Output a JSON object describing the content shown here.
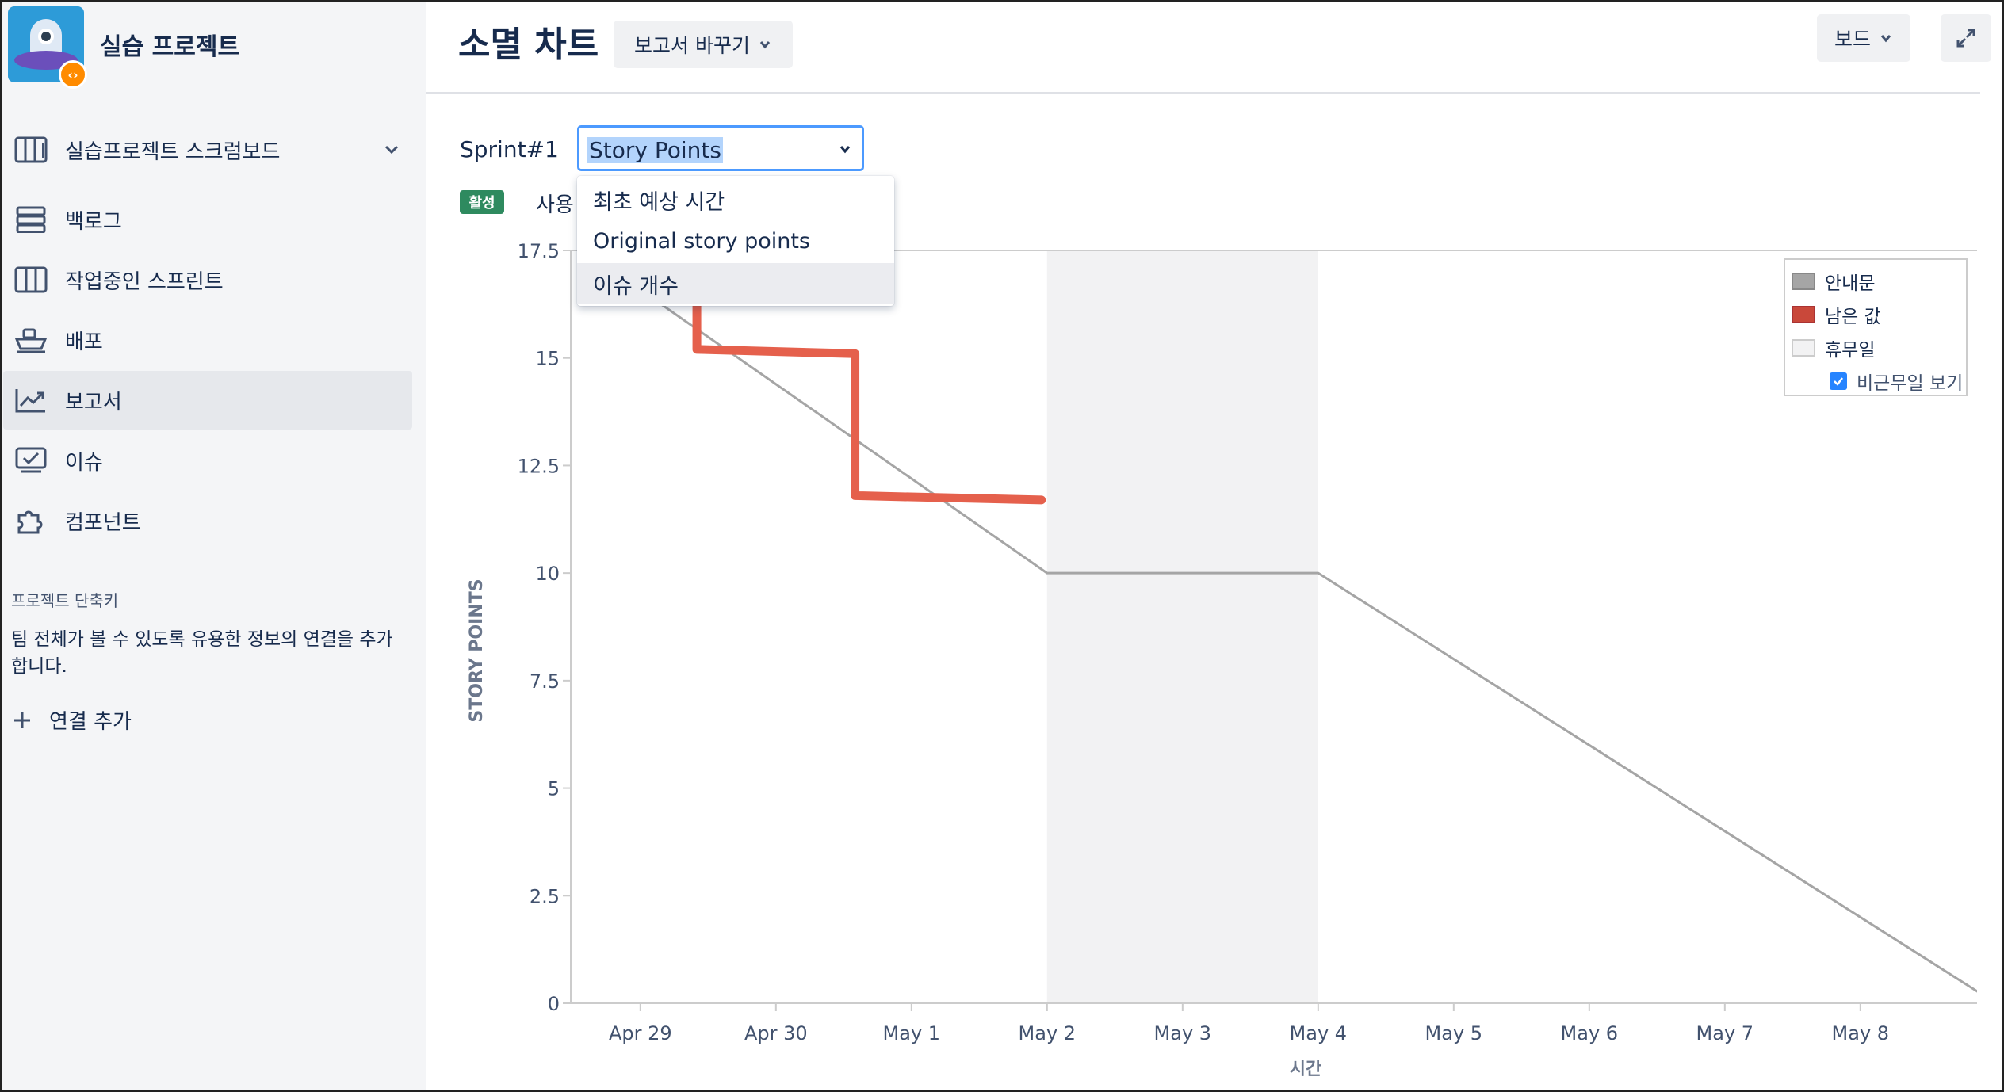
{
  "sidebar": {
    "project_name": "실습 프로젝트",
    "project_badge": "‹›",
    "items": [
      {
        "label": "실습프로젝트 스크럼보드",
        "icon": "board-icon"
      },
      {
        "label": "백로그",
        "icon": "backlog-icon"
      },
      {
        "label": "작업중인 스프린트",
        "icon": "sprint-columns-icon"
      },
      {
        "label": "배포",
        "icon": "ship-icon"
      },
      {
        "label": "보고서",
        "icon": "chart-line-icon",
        "selected": true
      },
      {
        "label": "이슈",
        "icon": "issues-icon"
      },
      {
        "label": "컴포넌트",
        "icon": "puzzle-icon"
      }
    ],
    "shortcuts_title": "프로젝트 단축키",
    "shortcuts_desc": "팀 전체가 볼 수 있도록 유용한 정보의 연결을 추가합니다.",
    "add_link": "연결 추가"
  },
  "header": {
    "title": "소멸 차트",
    "switch_report": "보고서 바꾸기",
    "board_button": "보드"
  },
  "controls": {
    "sprint_label": "Sprint#1",
    "estimate_selected": "Story Points",
    "options": [
      "최초 예상 시간",
      "Original story points",
      "이슈 개수"
    ],
    "highlighted_option": 2,
    "status_lozenge": "활성",
    "usage_text_partial": "사용"
  },
  "colors": {
    "guideline": "#a5a5a5",
    "remaining": "#e5604c",
    "nonworking": "#f2f2f3",
    "accent": "#4c9aff"
  },
  "chart_data": {
    "type": "line",
    "title": "",
    "xlabel": "시간",
    "ylabel": "STORY POINTS",
    "ylim": [
      0,
      17.5
    ],
    "y_ticks": [
      "0",
      "2.5",
      "5",
      "7.5",
      "10",
      "12.5",
      "15",
      "17.5"
    ],
    "x_ticks": [
      "Apr 29",
      "Apr 30",
      "May 1",
      "May 2",
      "May 3",
      "May 4",
      "May 5",
      "May 6",
      "May 7",
      "May 8"
    ],
    "nonworking_range": [
      "May 2",
      "May 4"
    ],
    "series": [
      {
        "name": "안내문",
        "color": "#a5a5a5",
        "points": [
          [
            "Apr 28 14:00",
            17.5
          ],
          [
            "May 2",
            10
          ],
          [
            "May 4",
            10
          ],
          [
            "May 9",
            0
          ]
        ]
      },
      {
        "name": "남은 값",
        "color": "#e5604c",
        "points": [
          [
            "Apr 28 14:00",
            17
          ],
          [
            "Apr 29 10:00",
            16.6
          ],
          [
            "Apr 29 10:00",
            15.2
          ],
          [
            "Apr 30 14:00",
            15.1
          ],
          [
            "Apr 30 14:00",
            11.8
          ],
          [
            "May 1 23:00",
            11.7
          ]
        ]
      }
    ],
    "legend": {
      "position": "top-right",
      "entries": [
        {
          "label": "안내문",
          "color": "#a5a5a5"
        },
        {
          "label": "남은 값",
          "color": "#c9483a"
        },
        {
          "label": "휴무일",
          "color": "#f2f2f3"
        }
      ],
      "show_nonworking_label": "비근무일 보기",
      "show_nonworking_checked": true
    },
    "grid": false
  }
}
